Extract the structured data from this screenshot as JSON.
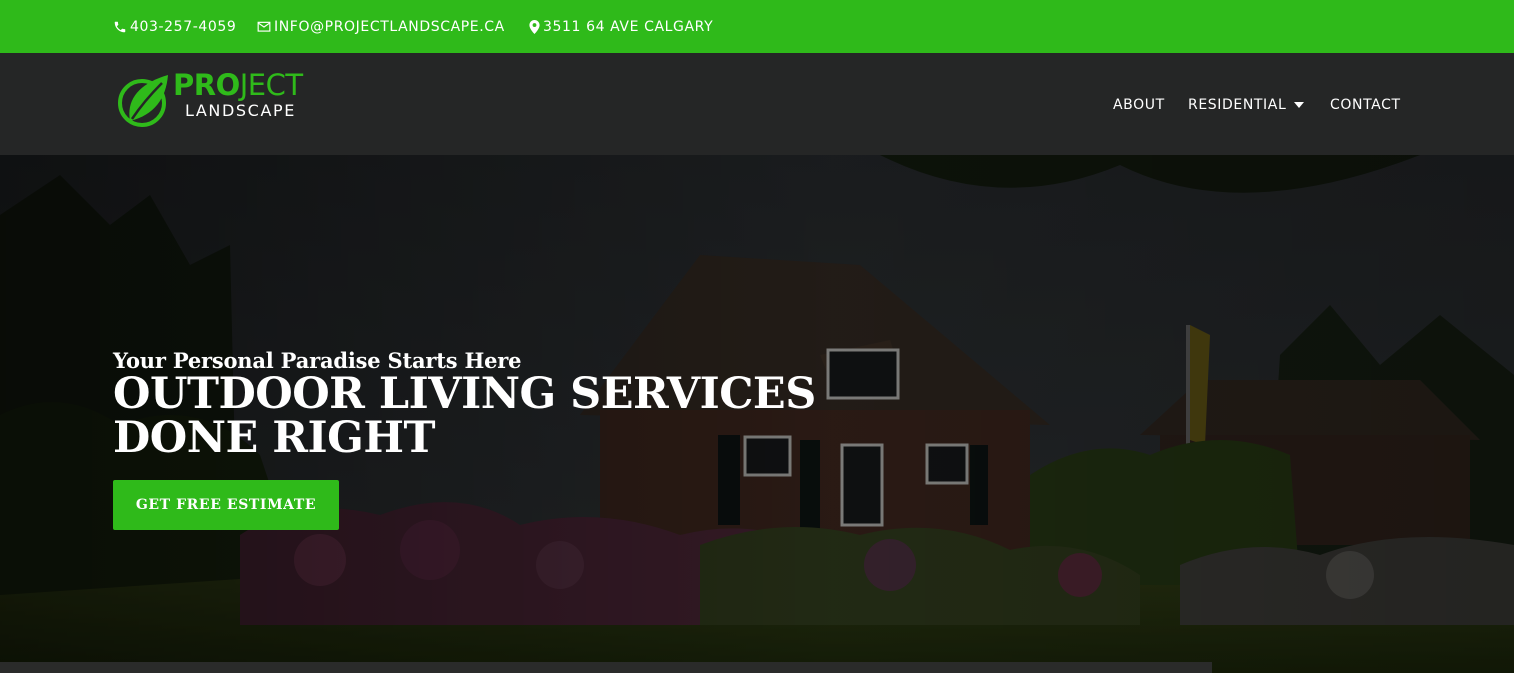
{
  "topbar": {
    "phone": "403-257-4059",
    "email": "INFO@PROJECTLANDSCAPE.CA",
    "address": "3511 64 AVE CALGARY",
    "icons": {
      "phone": "phone-icon",
      "email": "mail-icon",
      "address": "map-pin-icon"
    }
  },
  "logo": {
    "word_bold": "PRO",
    "word_rest": "JECT",
    "subtitle": "LANDSCAPE",
    "icon": "leaf-logo-icon"
  },
  "nav": {
    "items": [
      {
        "label": "ABOUT"
      },
      {
        "label": "RESIDENTIAL",
        "has_dropdown": true
      },
      {
        "label": "CONTACT"
      }
    ]
  },
  "hero": {
    "tagline": "Your Personal Paradise Starts Here",
    "headline": "OUTDOOR LIVING SERVICES DONE RIGHT",
    "cta_label": "GET FREE ESTIMATE"
  },
  "colors": {
    "brand_green": "#2fba1a",
    "nav_background": "#252626",
    "text": "#ffffff"
  }
}
